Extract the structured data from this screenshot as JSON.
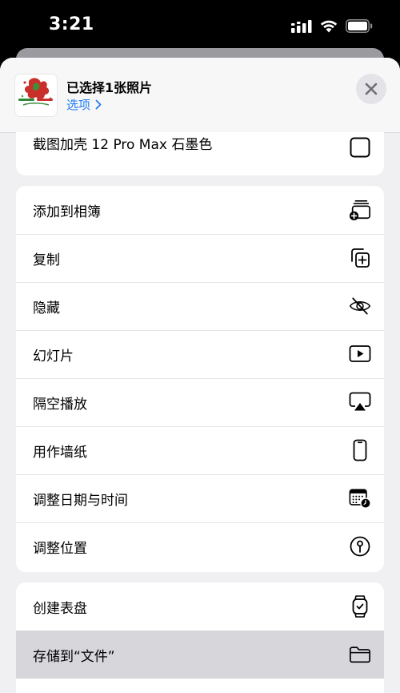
{
  "status_bar": {
    "time": "3:21"
  },
  "header": {
    "title": "已选择1张照片",
    "options_label": "选项",
    "options_chevron": "›",
    "thumbnail_icon": "photo-thumbnail"
  },
  "top_group": {
    "items": [
      {
        "label": "截图加壳 12 Pro Max 石墨色",
        "icon": "checkbox-icon"
      }
    ]
  },
  "main_group": {
    "items": [
      {
        "label": "添加到相簿",
        "icon": "add-to-album-icon"
      },
      {
        "label": "复制",
        "icon": "copy-icon"
      },
      {
        "label": "隐藏",
        "icon": "hide-eye-icon"
      },
      {
        "label": "幻灯片",
        "icon": "slideshow-play-icon"
      },
      {
        "label": "隔空播放",
        "icon": "airplay-icon"
      },
      {
        "label": "用作墙纸",
        "icon": "phone-wallpaper-icon"
      },
      {
        "label": "调整日期与时间",
        "icon": "calendar-clock-icon"
      },
      {
        "label": "调整位置",
        "icon": "location-pin-icon"
      }
    ]
  },
  "bottom_group": {
    "items": [
      {
        "label": "创建表盘",
        "icon": "watch-face-icon"
      },
      {
        "label": "存储到“文件”",
        "icon": "folder-icon",
        "highlighted": true
      }
    ]
  },
  "colors": {
    "accent": "#1e7cf2",
    "background": "#f0f0f2",
    "highlight": "#d6d6db"
  }
}
